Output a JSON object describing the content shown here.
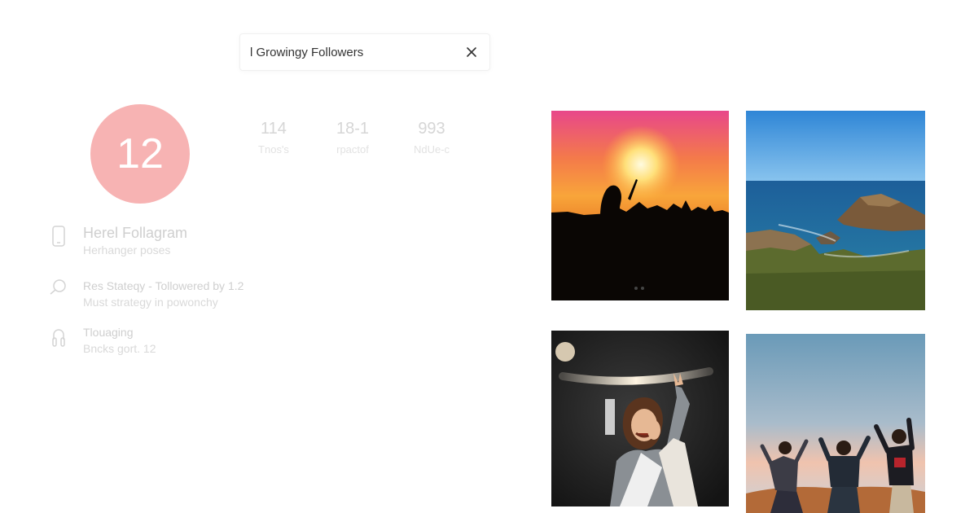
{
  "search": {
    "value": "l Growingy Followers"
  },
  "profile": {
    "avatar_text": "12",
    "stats": [
      {
        "value": "114",
        "label": "Tnos's"
      },
      {
        "value": "18-1",
        "label": "rpactof"
      },
      {
        "value": "993",
        "label": "NdUe-c"
      }
    ],
    "info": [
      {
        "title": "Herel Follagram",
        "subtitle": "Herhanger poses"
      },
      {
        "title": "Res Stateqy - Tollowered by 1.2",
        "subtitle": "Must strategy in powonchy"
      },
      {
        "title": "Tlouaging",
        "subtitle": "Bncks gort. 12"
      }
    ]
  },
  "gallery": {
    "photos": [
      {
        "name": "sunset-silhouette"
      },
      {
        "name": "coastal-cliffs"
      },
      {
        "name": "laughing-woman"
      },
      {
        "name": "group-celebrating"
      }
    ]
  },
  "colors": {
    "avatar": "#f7b3b3",
    "muted_text": "#d6d6d6"
  }
}
